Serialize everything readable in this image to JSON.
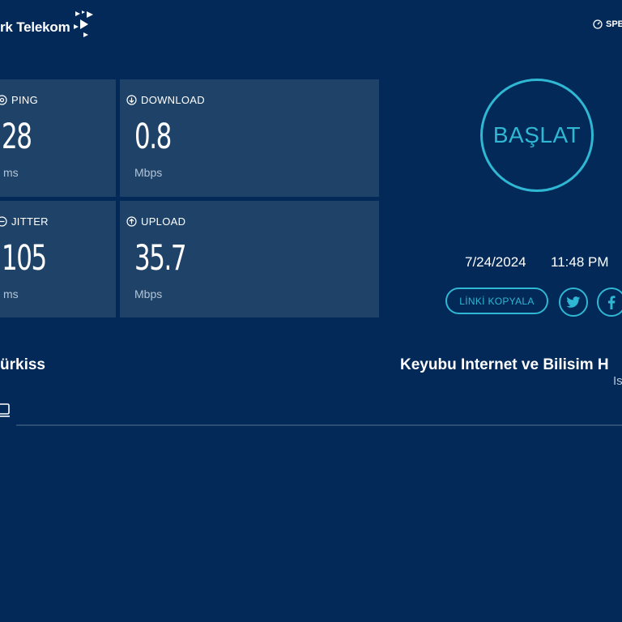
{
  "header": {
    "logo_text": "rk Telekom",
    "speed_link": "SPE"
  },
  "metrics": {
    "ping": {
      "label": "PING",
      "value": "28",
      "unit": "ms"
    },
    "download": {
      "label": "DOWNLOAD",
      "value": "0.8",
      "unit": "Mbps"
    },
    "jitter": {
      "label": "JITTER",
      "value": "105",
      "unit": "ms"
    },
    "upload": {
      "label": "UPLOAD",
      "value": "35.7",
      "unit": "Mbps"
    }
  },
  "controls": {
    "start_label": "BAŞLAT",
    "copy_link_label": "LİNKİ KOPYALA"
  },
  "result": {
    "date": "7/24/2024",
    "time": "11:48 PM"
  },
  "connection": {
    "left_label": "ürkiss",
    "isp_name": "Keyubu Internet ve Bilisim H",
    "isp_sub": "Is"
  },
  "colors": {
    "background": "#022957",
    "tile": "#1f4368",
    "accent": "#2fb7d3"
  },
  "icons": [
    "logo-arrows-icon",
    "gauge-icon",
    "ping-icon",
    "download-icon",
    "jitter-icon",
    "upload-icon",
    "twitter-icon",
    "facebook-icon",
    "laptop-icon"
  ]
}
